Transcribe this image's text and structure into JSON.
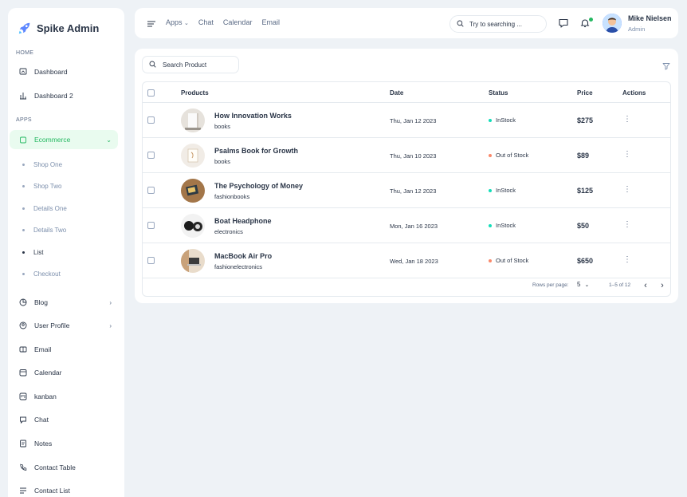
{
  "brand": {
    "name": "Spike Admin"
  },
  "sidebar": {
    "caption_home": "HOME",
    "caption_apps": "APPS",
    "home_items": [
      {
        "label": "Dashboard",
        "icon": "screen-icon"
      },
      {
        "label": "Dashboard 2",
        "icon": "chart-icon"
      }
    ],
    "ecommerce": {
      "label": "Ecommerce",
      "icon": "bag-icon"
    },
    "sub_items": [
      "Shop One",
      "Shop Two",
      "Details One",
      "Details Two",
      "List",
      "Checkout"
    ],
    "current_sub": "List",
    "app_items": [
      {
        "label": "Blog",
        "icon": "pie-icon",
        "has_children": true
      },
      {
        "label": "User Profile",
        "icon": "user-circle-icon",
        "has_children": true
      },
      {
        "label": "Email",
        "icon": "mail-icon"
      },
      {
        "label": "Calendar",
        "icon": "calendar-icon"
      },
      {
        "label": "kanban",
        "icon": "kanban-icon"
      },
      {
        "label": "Chat",
        "icon": "chat-icon"
      },
      {
        "label": "Notes",
        "icon": "notes-icon"
      },
      {
        "label": "Contact Table",
        "icon": "phone-icon"
      },
      {
        "label": "Contact List",
        "icon": "list-icon"
      }
    ]
  },
  "header": {
    "nav": [
      "Apps",
      "Chat",
      "Calendar",
      "Email"
    ],
    "search_placeholder": "Try to searching ...",
    "user_name": "Mike Nielsen",
    "user_role": "Admin"
  },
  "main": {
    "search_placeholder": "Search Product",
    "columns": {
      "products": "Products",
      "date": "Date",
      "status": "Status",
      "price": "Price",
      "actions": "Actions"
    },
    "rows": [
      {
        "name": "How Innovation Works",
        "category": "books",
        "date": "Thu, Jan 12 2023",
        "status": "InStock",
        "status_color": "#13deb9",
        "price": "$275",
        "thumb": "thumb-book-white"
      },
      {
        "name": "Psalms Book for Growth",
        "category": "books",
        "date": "Thu, Jan 10 2023",
        "status": "Out of Stock",
        "status_color": "#fa896b",
        "price": "$89",
        "thumb": "thumb-book-frame"
      },
      {
        "name": "The Psychology of Money",
        "category": "fashionbooks",
        "date": "Thu, Jan 12 2023",
        "status": "InStock",
        "status_color": "#13deb9",
        "price": "$125",
        "thumb": "thumb-book-wood"
      },
      {
        "name": "Boat Headphone",
        "category": "electronics",
        "date": "Mon, Jan 16 2023",
        "status": "InStock",
        "status_color": "#13deb9",
        "price": "$50",
        "thumb": "thumb-headphone"
      },
      {
        "name": "MacBook Air Pro",
        "category": "fashionelectronics",
        "date": "Wed, Jan 18 2023",
        "status": "Out of Stock",
        "status_color": "#fa896b",
        "price": "$650",
        "thumb": "thumb-laptop"
      }
    ],
    "pager": {
      "rows_label": "Rows per page:",
      "rows_value": "5",
      "range": "1–5 of 12"
    }
  },
  "colors": {
    "accent": "#24b861",
    "instock": "#13deb9",
    "outofstock": "#fa896b",
    "background": "#eef2f6"
  }
}
